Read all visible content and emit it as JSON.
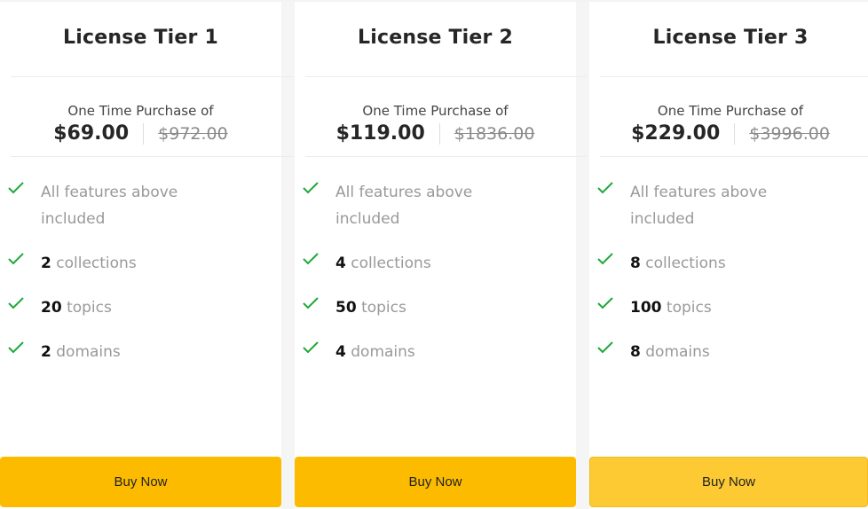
{
  "colors": {
    "accent": "#fdbb00",
    "accent_hover": "#fdca33",
    "check": "#1fa83a"
  },
  "tiers": [
    {
      "title": "License Tier 1",
      "purchase_label": "One Time Purchase of",
      "price": "$69.00",
      "original_price": "$972.00",
      "features": [
        {
          "num": "",
          "text": "All features above included"
        },
        {
          "num": "2",
          "text": "collections"
        },
        {
          "num": "20",
          "text": "topics"
        },
        {
          "num": "2",
          "text": "domains"
        }
      ],
      "button": "Buy Now"
    },
    {
      "title": "License Tier 2",
      "purchase_label": "One Time Purchase of",
      "price": "$119.00",
      "original_price": "$1836.00",
      "features": [
        {
          "num": "",
          "text": "All features above included"
        },
        {
          "num": "4",
          "text": "collections"
        },
        {
          "num": "50",
          "text": "topics"
        },
        {
          "num": "4",
          "text": "domains"
        }
      ],
      "button": "Buy Now"
    },
    {
      "title": "License Tier 3",
      "purchase_label": "One Time Purchase of",
      "price": "$229.00",
      "original_price": "$3996.00",
      "features": [
        {
          "num": "",
          "text": "All features above included"
        },
        {
          "num": "8",
          "text": "collections"
        },
        {
          "num": "100",
          "text": "topics"
        },
        {
          "num": "8",
          "text": "domains"
        }
      ],
      "button": "Buy Now"
    }
  ]
}
